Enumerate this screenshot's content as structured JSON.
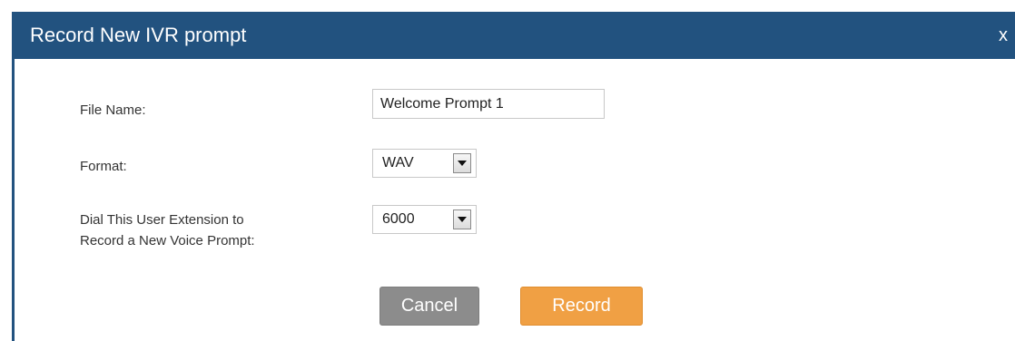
{
  "dialog": {
    "title": "Record New IVR prompt",
    "close_label": "x"
  },
  "form": {
    "file_name_label": "File Name:",
    "file_name_value": "Welcome Prompt 1",
    "format_label": "Format:",
    "format_value": "WAV",
    "extension_label_line1": "Dial This User Extension to",
    "extension_label_line2": "Record a New Voice Prompt:",
    "extension_value": "6000"
  },
  "buttons": {
    "cancel_label": "Cancel",
    "record_label": "Record"
  },
  "colors": {
    "titlebar": "#22527f",
    "cancel_button": "#8c8c8c",
    "record_button": "#f0a044"
  }
}
